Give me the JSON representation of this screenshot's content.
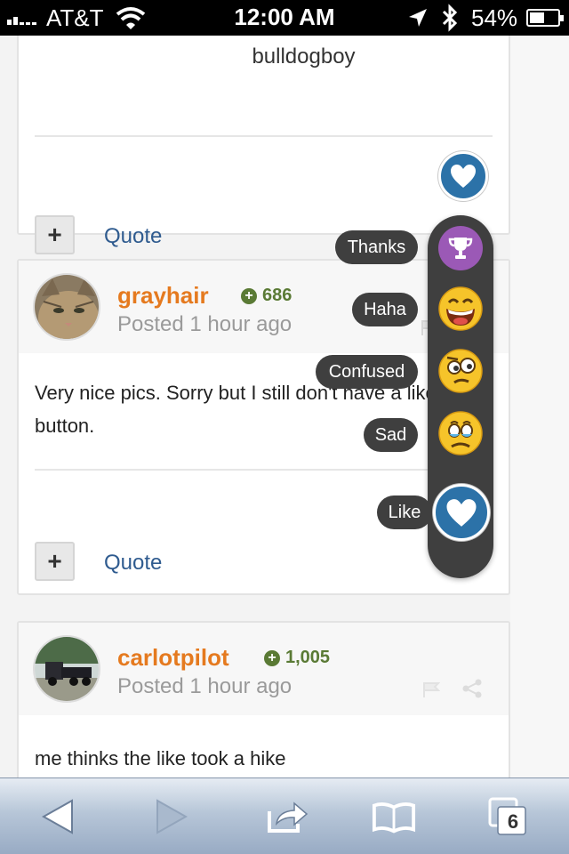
{
  "status_bar": {
    "carrier": "AT&T",
    "time": "12:00 AM",
    "battery": "54%",
    "battery_level": 0.54,
    "icons": [
      "signal-icon",
      "wifi-icon",
      "location-icon",
      "bluetooth-icon",
      "battery-icon"
    ]
  },
  "post1": {
    "signature": "bulldogboy",
    "multiquote_label": "+",
    "quote_label": "Quote"
  },
  "post2": {
    "username": "grayhair",
    "reputation": "686",
    "posted": "Posted 1 hour ago",
    "body": "Very nice pics.  Sorry but I still don't have a like button.",
    "multiquote_label": "+",
    "quote_label": "Quote"
  },
  "post3": {
    "username": "carlotpilot",
    "reputation": "1,005",
    "posted": "Posted 1 hour ago",
    "body": "me thinks the like took a hike"
  },
  "reactions": {
    "thanks": "Thanks",
    "haha": "Haha",
    "confused": "Confused",
    "sad": "Sad",
    "like": "Like"
  },
  "toolbar": {
    "tab_count": "6",
    "icons": [
      "back-icon",
      "forward-icon",
      "share-icon",
      "bookmarks-icon",
      "tabs-icon"
    ]
  },
  "colors": {
    "username": "#e57a1f",
    "reputation": "#5a7a35",
    "link": "#2f5b8f",
    "like": "#2c72a8",
    "thanks": "#9b59b6",
    "popup": "#3f3f3f"
  }
}
